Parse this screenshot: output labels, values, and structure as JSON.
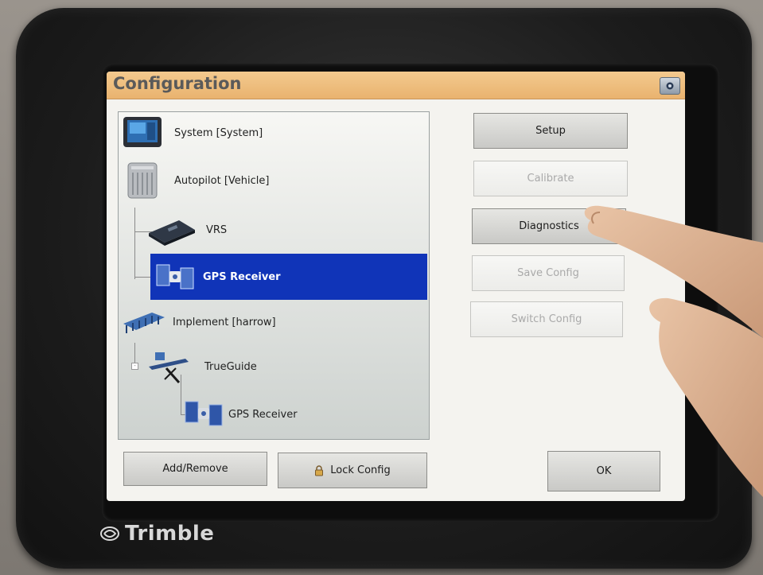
{
  "device": {
    "brand": "Trimble"
  },
  "window": {
    "title": "Configuration"
  },
  "tree": {
    "items": [
      {
        "label": "System [System]",
        "icon": "display-icon",
        "selected": false
      },
      {
        "label": "Autopilot [Vehicle]",
        "icon": "autopilot-controller-icon",
        "selected": false
      },
      {
        "label": "VRS",
        "icon": "vrs-radio-icon",
        "selected": false
      },
      {
        "label": "GPS Receiver",
        "icon": "gps-satellite-icon",
        "selected": true
      },
      {
        "label": "Implement [harrow]",
        "icon": "harrow-icon",
        "selected": false
      },
      {
        "label": "TrueGuide",
        "icon": "trueguide-icon",
        "selected": false
      },
      {
        "label": "GPS Receiver",
        "icon": "gps-satellite-icon",
        "selected": false
      }
    ]
  },
  "actions": {
    "setup": "Setup",
    "calibrate": "Calibrate",
    "diagnostics": "Diagnostics",
    "save_config": "Save Config",
    "switch_config": "Switch Config"
  },
  "footer": {
    "add_remove": "Add/Remove",
    "lock_config": "Lock Config",
    "ok": "OK"
  },
  "colors": {
    "titlebar": "#e9b36f",
    "selection": "#1034b8"
  }
}
